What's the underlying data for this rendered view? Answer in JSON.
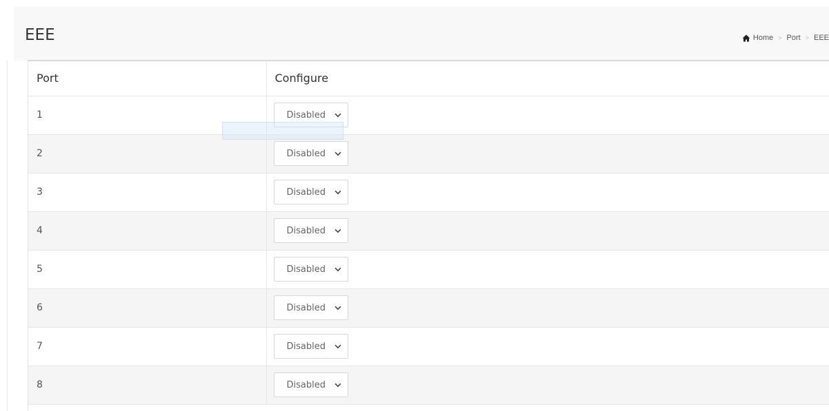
{
  "title": "EEE",
  "breadcrumb": {
    "home": "Home",
    "port": "Port",
    "current": "EEE"
  },
  "table": {
    "headers": {
      "port": "Port",
      "configure": "Configure"
    },
    "rows": [
      {
        "port": "1",
        "value": "Disabled"
      },
      {
        "port": "2",
        "value": "Disabled"
      },
      {
        "port": "3",
        "value": "Disabled"
      },
      {
        "port": "4",
        "value": "Disabled"
      },
      {
        "port": "5",
        "value": "Disabled"
      },
      {
        "port": "6",
        "value": "Disabled"
      },
      {
        "port": "7",
        "value": "Disabled"
      },
      {
        "port": "8",
        "value": "Disabled"
      }
    ]
  },
  "icons": {
    "home": "home-icon",
    "dropdown": "chevron-down-icon"
  },
  "colors": {
    "header_band": "#f8f8f8",
    "alt_row": "#f5f5f5",
    "border": "#e6e6e6"
  }
}
